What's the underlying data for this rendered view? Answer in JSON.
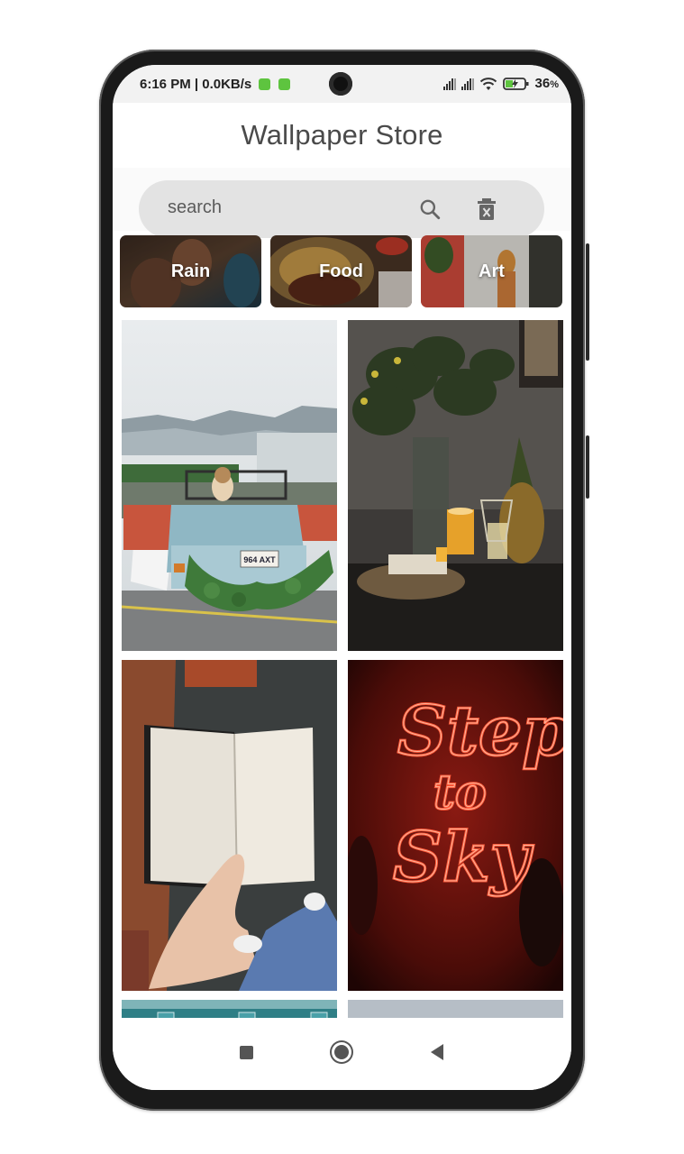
{
  "status_bar": {
    "time_text": "6:16 PM | 0.0KB/s",
    "battery_text": "36",
    "battery_unit": "%",
    "icons": [
      "app-notification-icon",
      "app-notification-icon",
      "signal-icon",
      "signal-icon",
      "wifi-icon",
      "battery-charging-icon"
    ]
  },
  "app_bar": {
    "title": "Wallpaper Store"
  },
  "search": {
    "placeholder": "search",
    "value": "",
    "search_icon": "search-icon",
    "clear_icon": "delete-icon"
  },
  "categories": [
    {
      "label": "Rain"
    },
    {
      "label": "Food"
    },
    {
      "label": "Art"
    }
  ],
  "wallpapers": [
    {
      "description": "wedding-car"
    },
    {
      "description": "candle-table"
    },
    {
      "description": "open-notebook"
    },
    {
      "description": "neon-sign"
    },
    {
      "description": "teal-room"
    },
    {
      "description": "grey-sky"
    }
  ],
  "neon_text": {
    "line1": "Step",
    "line2": "to",
    "line3": "Sky"
  },
  "plate_text": "964 AXT",
  "nav_bar": {
    "icons": [
      "recents-square-icon",
      "home-circle-icon",
      "back-triangle-icon"
    ]
  },
  "colors": {
    "accent": "#5ec43f",
    "search_bg": "#e3e3e3",
    "title": "#4a4a4a"
  }
}
